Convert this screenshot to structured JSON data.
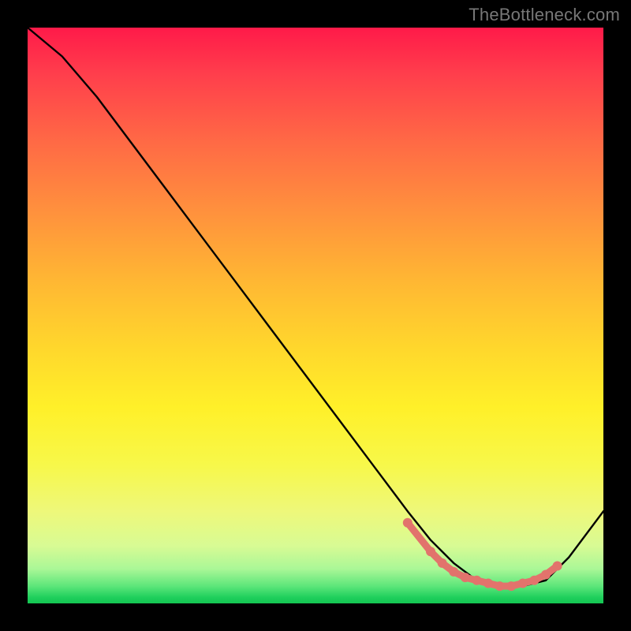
{
  "watermark": "TheBottleneck.com",
  "chart_data": {
    "type": "line",
    "title": "",
    "xlabel": "",
    "ylabel": "",
    "xlim": [
      0,
      100
    ],
    "ylim": [
      0,
      100
    ],
    "series": [
      {
        "name": "bottleneck-curve",
        "x": [
          0,
          6,
          12,
          18,
          24,
          30,
          36,
          42,
          48,
          54,
          60,
          66,
          70,
          74,
          78,
          82,
          86,
          90,
          94,
          100
        ],
        "values": [
          100,
          95,
          88,
          80,
          72,
          64,
          56,
          48,
          40,
          32,
          24,
          16,
          11,
          7,
          4,
          3,
          3,
          4,
          8,
          16
        ]
      }
    ],
    "markers": {
      "name": "optimal-range",
      "color": "#e2736c",
      "x": [
        66,
        70,
        72,
        74,
        76,
        78,
        80,
        82,
        84,
        86,
        88,
        90,
        92
      ],
      "values": [
        14,
        9,
        7,
        5.5,
        4.5,
        4,
        3.5,
        3,
        3,
        3.5,
        4,
        5,
        6.5
      ]
    }
  }
}
